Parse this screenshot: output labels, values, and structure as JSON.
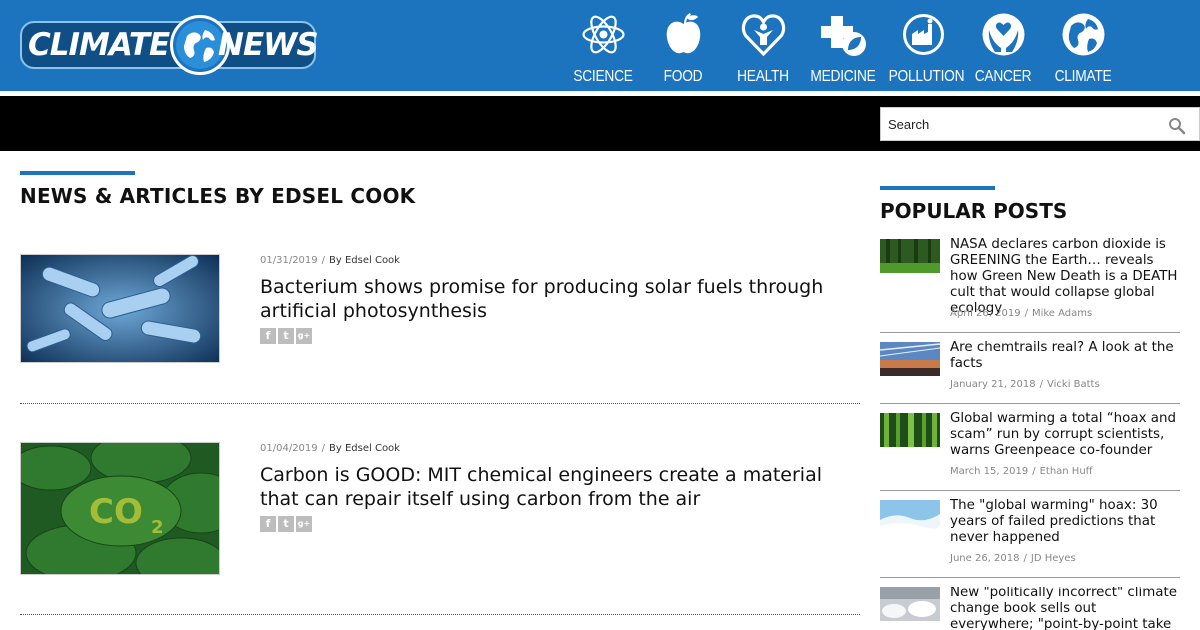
{
  "site": {
    "logo_left": "CLIMATE",
    "logo_right": "NEWS",
    "brand_color": "#1b74bd"
  },
  "nav": {
    "items": [
      {
        "label": "SCIENCE",
        "icon": "atom-icon"
      },
      {
        "label": "FOOD",
        "icon": "apple-icon"
      },
      {
        "label": "HEALTH",
        "icon": "heart-person-icon"
      },
      {
        "label": "MEDICINE",
        "icon": "medical-cross-leaf-icon"
      },
      {
        "label": "POLLUTION",
        "icon": "factory-icon"
      },
      {
        "label": "CANCER",
        "icon": "hands-heart-icon"
      },
      {
        "label": "CLIMATE",
        "icon": "globe-icon"
      }
    ]
  },
  "search": {
    "placeholder": "Search",
    "icon": "search-icon"
  },
  "main": {
    "title": "NEWS & ARTICLES BY EDSEL COOK",
    "articles": [
      {
        "date": "01/31/2019",
        "author": "By Edsel Cook",
        "title": "Bacterium shows promise for producing solar fuels through artificial photosynthesis",
        "image": "bacteria-image"
      },
      {
        "date": "01/04/2019",
        "author": "By Edsel Cook",
        "title": "Carbon is GOOD: MIT chemical engineers create a material that can repair itself using carbon from the air",
        "image": "co2-leaves-image"
      }
    ],
    "share_icons": [
      "f",
      "t",
      "g+"
    ]
  },
  "sidebar": {
    "title": "POPULAR POSTS",
    "posts": [
      {
        "title": "NASA declares carbon dioxide is GREENING the Earth… reveals how Green New Death is a DEATH cult that would collapse global ecology",
        "date": "April 26, 2019",
        "author": "Mike Adams"
      },
      {
        "title": "Are chemtrails real? A look at the facts",
        "date": "January 21, 2018",
        "author": "Vicki Batts"
      },
      {
        "title": "Global warming a total “hoax and scam” run by corrupt scientists, warns Greenpeace co-founder",
        "date": "March 15, 2019",
        "author": "Ethan Huff"
      },
      {
        "title": "The \"global warming\" hoax: 30 years of failed predictions that never happened",
        "date": "June 26, 2018",
        "author": "JD Heyes"
      },
      {
        "title": "New \"politically incorrect\" climate change book sells out everywhere; \"point-by-point take down\" of",
        "date": "",
        "author": ""
      }
    ]
  }
}
